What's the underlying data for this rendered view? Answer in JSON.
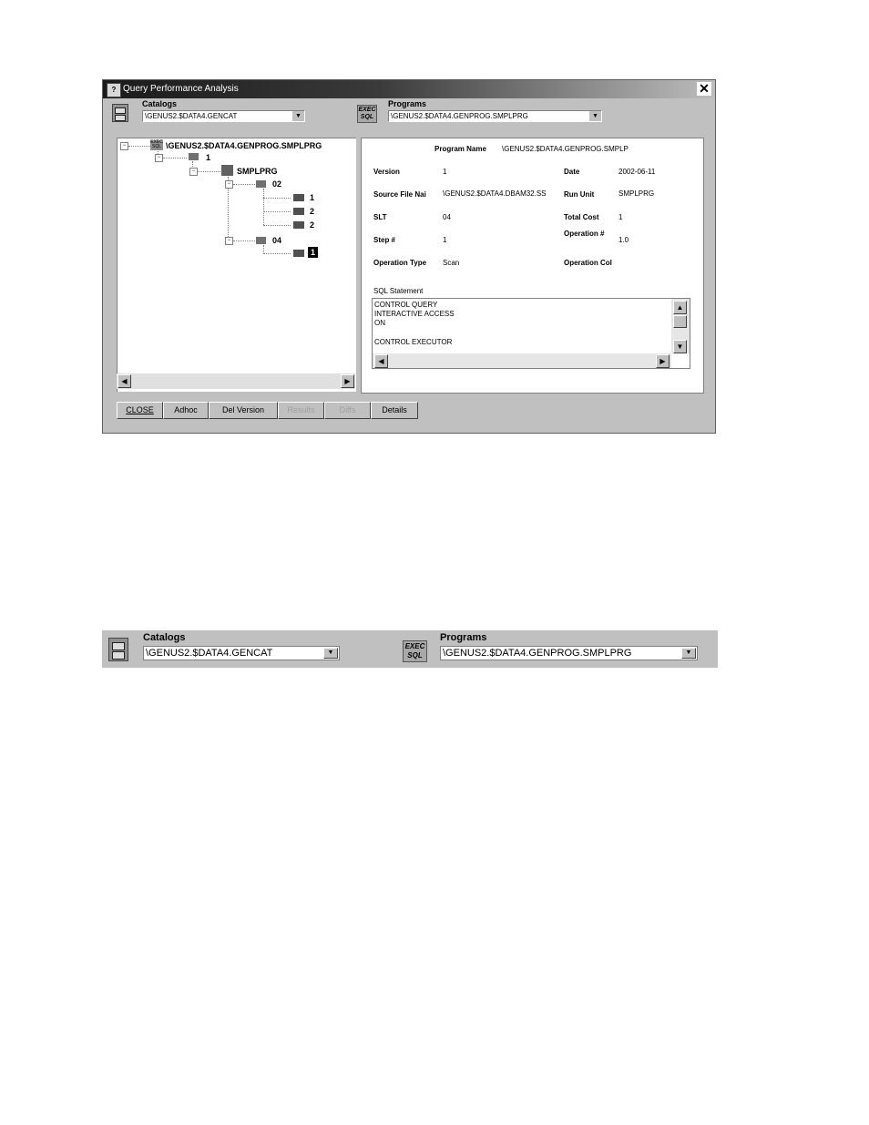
{
  "window": {
    "title": "Query Performance Analysis",
    "close_glyph": "✕",
    "app_icon_text": "?"
  },
  "catalogs": {
    "label": "Catalogs",
    "value": "\\GENUS2.$DATA4.GENCAT",
    "icon": "catalog-icon"
  },
  "programs": {
    "label": "Programs",
    "value": "\\GENUS2.$DATA4.GENPROG.SMPLPRG",
    "icon_text_1": "EXEC",
    "icon_text_2": "SQL"
  },
  "tree": {
    "root": "\\GENUS2.$DATA4.GENPROG.SMPLPRG",
    "root_icon_text": "EXEC SQL",
    "node_1": "1",
    "program": "SMPLPRG",
    "stmt_02": "02",
    "op_1": "1",
    "op_2a": "2",
    "op_2b": "2",
    "stmt_04": "04",
    "op_selected": "1"
  },
  "details": {
    "program_name_label": "Program Name",
    "program_name_value": "\\GENUS2.$DATA4.GENPROG.SMPLP",
    "version_label": "Version",
    "version_value": "1",
    "date_label": "Date",
    "date_value": "2002-06-11",
    "source_file_label": "Source File Nai",
    "source_file_value": "\\GENUS2.$DATA4.DBAM32.SS",
    "run_unit_label": "Run Unit",
    "run_unit_value": "SMPLPRG",
    "slt_label": "SLT",
    "slt_value": "04",
    "total_cost_label": "Total Cost",
    "total_cost_value": "1",
    "step_label": "Step #",
    "step_value": "1",
    "operation_num_label": "Operation #",
    "operation_num_value": "1.0",
    "operation_type_label": "Operation Type",
    "operation_type_value": "Scan",
    "operation_col_label": "Operation Col",
    "sql_statement_label": "SQL Statement",
    "sql_lines": [
      "CONTROL QUERY",
      "INTERACTIVE ACCESS",
      "ON",
      "",
      "CONTROL EXECUTOR"
    ]
  },
  "buttons": {
    "close": "CLOSE",
    "adhoc": "Adhoc",
    "del_version": "Del Version",
    "results": "Results",
    "diffs": "Diffs",
    "details": "Details"
  },
  "strip": {
    "catalogs_label": "Catalogs",
    "catalogs_value": "\\GENUS2.$DATA4.GENCAT",
    "programs_label": "Programs",
    "programs_value": "\\GENUS2.$DATA4.GENPROG.SMPLPRG",
    "sql_icon_1": "EXEC",
    "sql_icon_2": "SQL"
  }
}
